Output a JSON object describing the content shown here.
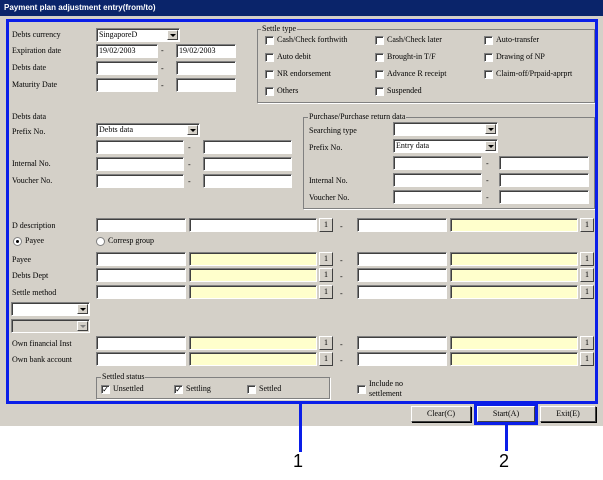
{
  "window": {
    "title": "Payment plan adjustment entry(from/to)"
  },
  "header": {
    "debts_currency_label": "Debts currency",
    "debts_currency_value": "SingaporeD",
    "expiration_date_label": "Expiration date",
    "expiration_from": "19/02/2003",
    "expiration_to": "19/02/2003",
    "debts_date_label": "Debts date",
    "maturity_date_label": "Maturity Date",
    "dash": "-"
  },
  "settle_type": {
    "title": "Settle type",
    "options": [
      "Cash/Check forthwith",
      "Cash/Check later",
      "Auto-transfer",
      "Auto debit",
      "Brought-in T/F",
      "Drawing of NP",
      "NR endorsement",
      "Advance R receipt",
      "Claim-off/Prpaid-aprprt",
      "Others",
      "Suspended"
    ]
  },
  "debts_data": {
    "title": "Debts data",
    "prefix_label": "Prefix No.",
    "prefix_value": "Debts data",
    "internal_label": "Internal No.",
    "voucher_label": "Voucher No."
  },
  "purchase_data": {
    "title": "Purchase/Purchase return data",
    "searching_label": "Searching type",
    "prefix_label": "Prefix No.",
    "prefix_value": "Entry data",
    "internal_label": "Internal No.",
    "voucher_label": "Voucher No."
  },
  "lower": {
    "d_description_label": "D description",
    "payee_radio": "Payee",
    "corresp_radio": "Corresp group",
    "payee_label": "Payee",
    "debts_dept_label": "Debts Dept",
    "settle_method_label": "Settle method",
    "own_financial_label": "Own financial Inst",
    "own_bank_label": "Own bank account",
    "lookup_button": "1"
  },
  "settled_status": {
    "title": "Settled status",
    "unsettled": "Unsettled",
    "settling": "Settling",
    "settled": "Settled",
    "check_mark": "✓"
  },
  "include_no_settlement": "Include no settlement",
  "buttons": {
    "clear": "Clear(C)",
    "start": "Start(A)",
    "exit": "Exit(E)"
  },
  "callouts": {
    "one": "1",
    "two": "2"
  }
}
